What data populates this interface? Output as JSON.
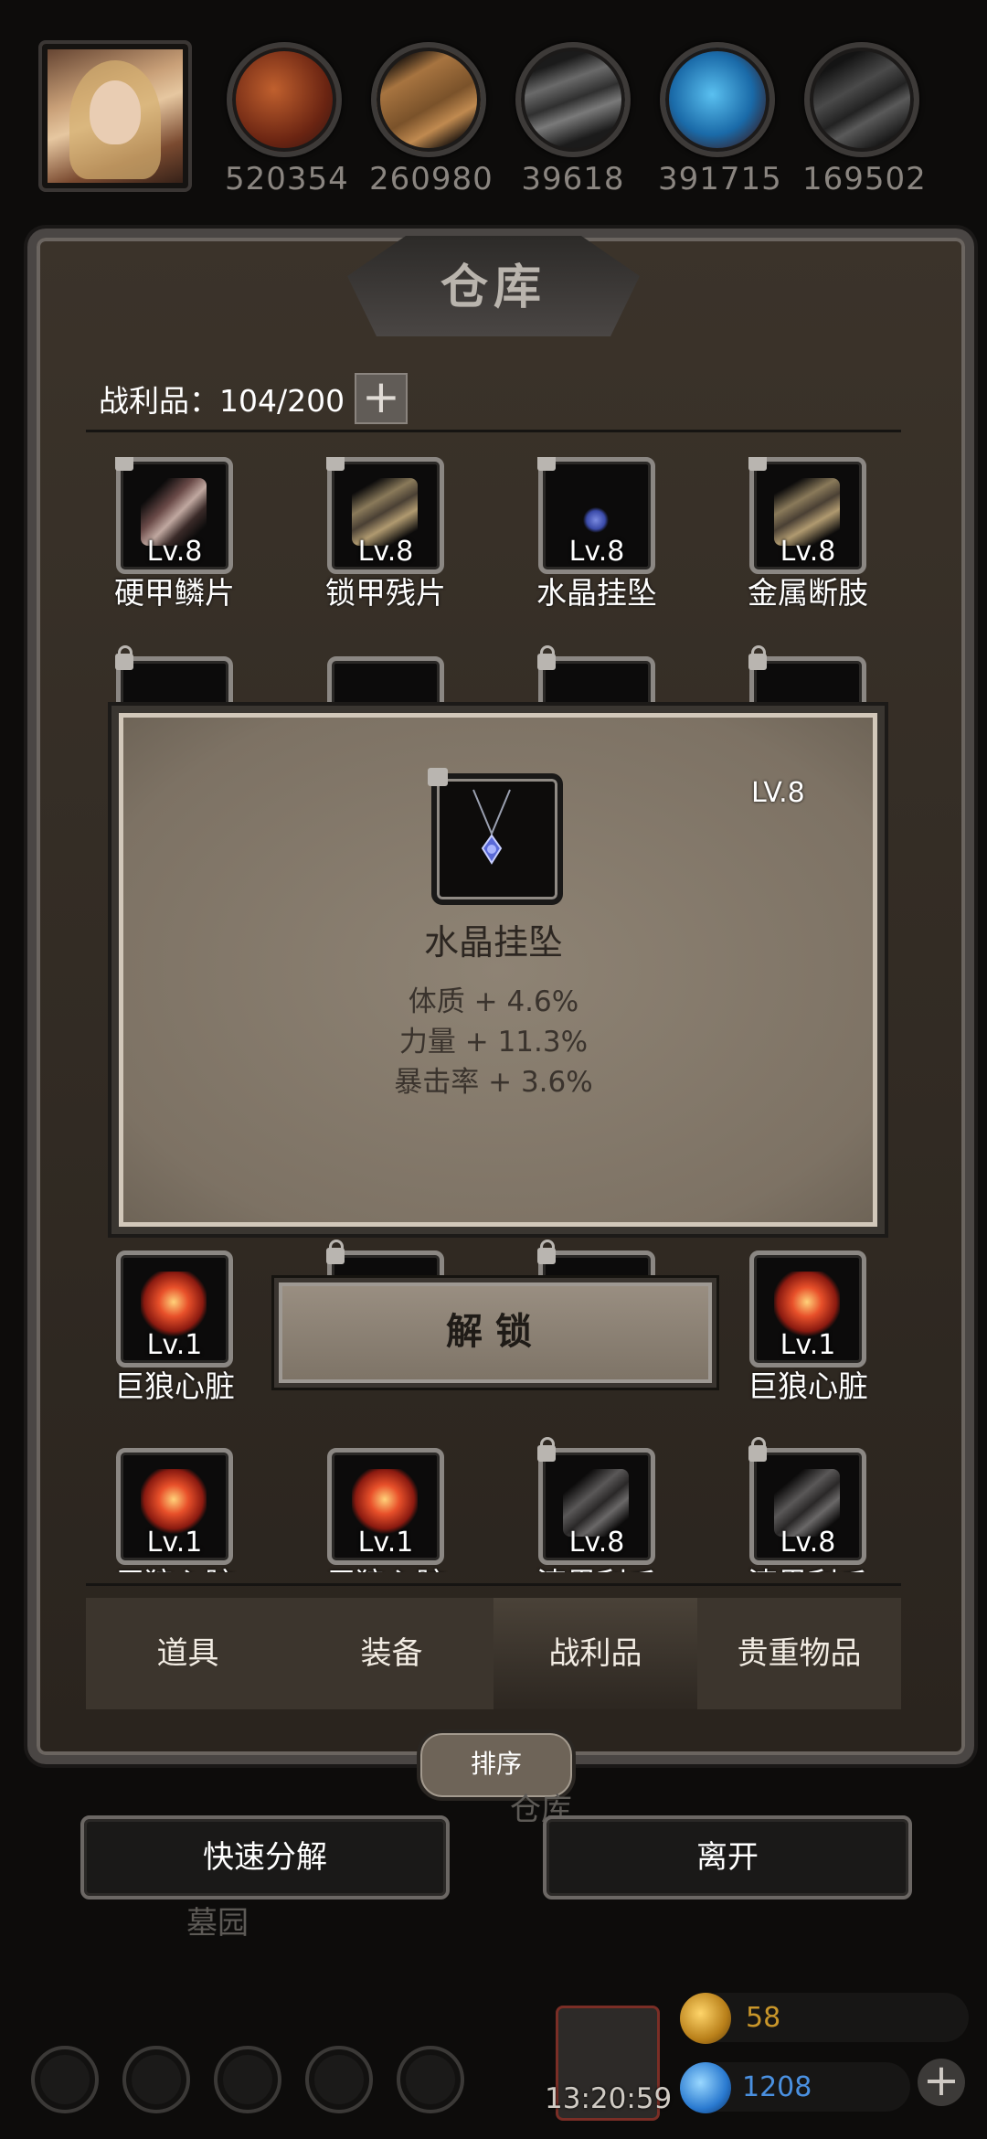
{
  "resources": [
    {
      "icon": "meat-icon",
      "value": "520354",
      "color": "#8a3a20"
    },
    {
      "icon": "wood-icon",
      "value": "260980",
      "color": "#9a6a38"
    },
    {
      "icon": "iron-ingot-icon",
      "value": "39618",
      "color": "#5a5a5a"
    },
    {
      "icon": "crystal-icon",
      "value": "391715",
      "color": "#2a8ac8"
    },
    {
      "icon": "dark-metal-icon",
      "value": "169502",
      "color": "#3a3a3a"
    }
  ],
  "panel": {
    "title": "仓库",
    "loot_label": "战利品：104/200",
    "plus": "+"
  },
  "items": [
    {
      "name": "硬甲鳞片",
      "level": "Lv.8",
      "locked": true,
      "icon": "scale-icon"
    },
    {
      "name": "锁甲残片",
      "level": "Lv.8",
      "locked": true,
      "icon": "armor-shard-icon"
    },
    {
      "name": "水晶挂坠",
      "level": "Lv.8",
      "locked": true,
      "icon": "pendant-icon"
    },
    {
      "name": "金属断肢",
      "level": "Lv.8",
      "locked": true,
      "icon": "metal-limb-icon"
    },
    {
      "name": "巨狼心脏",
      "level": "Lv.1",
      "locked": false,
      "icon": "heart-icon"
    },
    {
      "name": "巨狼心脏",
      "level": "Lv.1",
      "locked": false,
      "icon": "heart-icon"
    },
    {
      "name": "巨狼心脏",
      "level": "Lv.1",
      "locked": false,
      "icon": "heart-icon"
    },
    {
      "name": "巨狼心脏",
      "level": "Lv.1",
      "locked": false,
      "icon": "heart-icon"
    },
    {
      "name": "漆黑利爪",
      "level": "Lv.8",
      "locked": true,
      "icon": "claw-icon"
    },
    {
      "name": "漆黑利爪",
      "level": "Lv.8",
      "locked": true,
      "icon": "claw-icon"
    }
  ],
  "tooltip": {
    "level": "LV.8",
    "name": "水晶挂坠",
    "stats": [
      "体质 + 4.6%",
      "力量 + 11.3%",
      "暴击率 + 3.6%"
    ],
    "unlock_button": "解锁"
  },
  "tabs": [
    {
      "label": "道具",
      "active": false
    },
    {
      "label": "装备",
      "active": false
    },
    {
      "label": "战利品",
      "active": true
    },
    {
      "label": "贵重物品",
      "active": false
    }
  ],
  "sort_button": "排序",
  "quick_decompose": "快速分解",
  "leave": "离开",
  "background_labels": {
    "warehouse": "仓库",
    "graveyard": "墓园"
  },
  "timer": "13:20:59",
  "currencies": [
    {
      "icon": "gold-coin-icon",
      "value": "58",
      "color": "#c9962a"
    },
    {
      "icon": "blue-gem-icon",
      "value": "1208",
      "color": "#3a8ad8"
    }
  ],
  "colors": {
    "accent_gold": "#c9962a",
    "blue_text": "#4a90e0"
  }
}
